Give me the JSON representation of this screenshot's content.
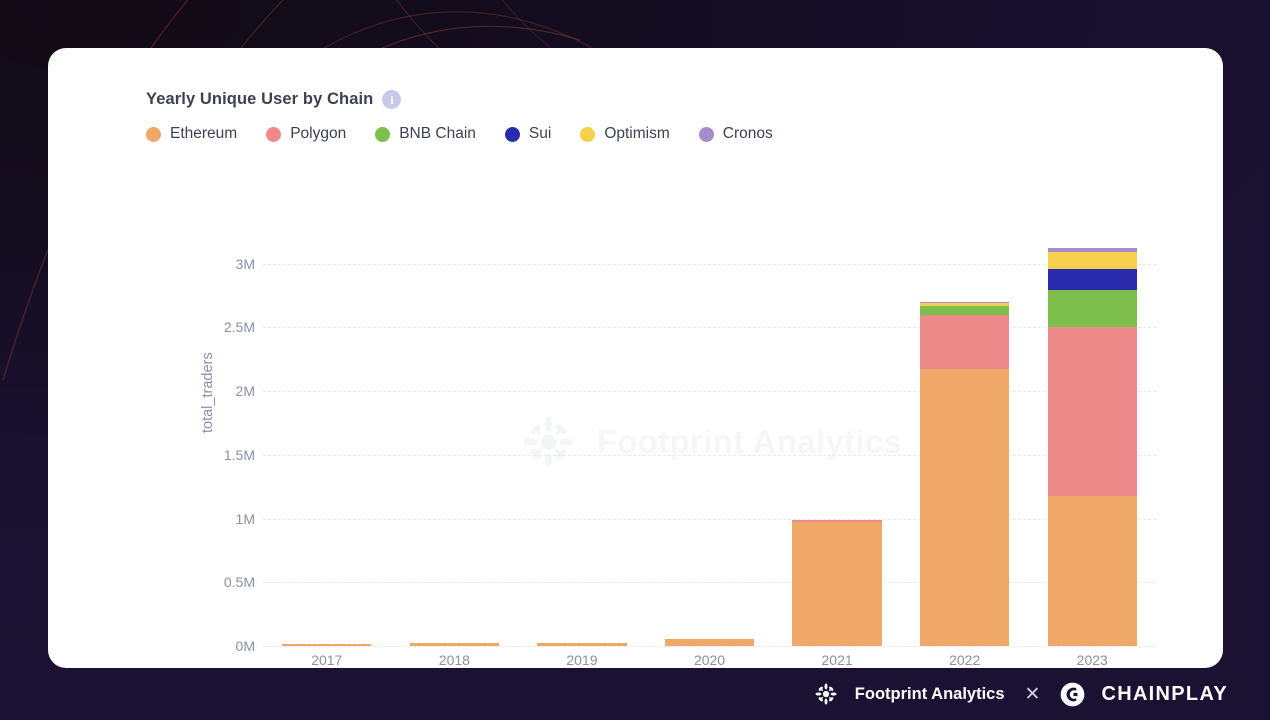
{
  "header": {
    "title": "Yearly Unique User by Chain",
    "info_icon": "info-icon",
    "info_glyph": "i"
  },
  "legend": {
    "items": [
      {
        "label": "Ethereum",
        "color": "#F0A868"
      },
      {
        "label": "Polygon",
        "color": "#EF8A8A"
      },
      {
        "label": "BNB Chain",
        "color": "#7DBE4C"
      },
      {
        "label": "Sui",
        "color": "#2A2AAD"
      },
      {
        "label": "Optimism",
        "color": "#F6D04D"
      },
      {
        "label": "Cronos",
        "color": "#A78BCA"
      }
    ]
  },
  "watermark": {
    "text": "Footprint Analytics",
    "icon": "footprint-sun-icon"
  },
  "footer": {
    "footprint_name": "Footprint Analytics",
    "footprint_icon": "footprint-sun-icon",
    "separator": "✕",
    "chainplay_name": "CHAINPLAY",
    "chainplay_icon": "chainplay-logo-icon"
  },
  "chart_data": {
    "type": "bar",
    "subtype": "stacked",
    "title": "Yearly Unique User by Chain",
    "xlabel": "",
    "ylabel": "total_traders",
    "categories": [
      "2017",
      "2018",
      "2019",
      "2020",
      "2021",
      "2022",
      "2023"
    ],
    "ytick_labels": [
      "0M",
      "0.5M",
      "1M",
      "1.5M",
      "2M",
      "2.5M",
      "3M"
    ],
    "ytick_values": [
      0,
      500000,
      1000000,
      1500000,
      2000000,
      2500000,
      3000000
    ],
    "ylim": [
      0,
      3200000
    ],
    "grid": true,
    "grid_style": "dashed",
    "legend_position": "top-left",
    "series": [
      {
        "name": "Ethereum",
        "color": "#F0A868",
        "values": [
          18000,
          22000,
          20000,
          55000,
          975000,
          2170000,
          1180000
        ]
      },
      {
        "name": "Polygon",
        "color": "#EF8A8A",
        "values": [
          0,
          0,
          0,
          0,
          12000,
          430000,
          1320000
        ]
      },
      {
        "name": "BNB Chain",
        "color": "#7DBE4C",
        "values": [
          0,
          0,
          0,
          0,
          0,
          70000,
          290000
        ]
      },
      {
        "name": "Sui",
        "color": "#2A2AAD",
        "values": [
          0,
          0,
          0,
          0,
          0,
          0,
          170000
        ]
      },
      {
        "name": "Optimism",
        "color": "#F6D04D",
        "values": [
          0,
          0,
          0,
          0,
          0,
          20000,
          130000
        ]
      },
      {
        "name": "Cronos",
        "color": "#A78BCA",
        "values": [
          0,
          0,
          0,
          0,
          0,
          10000,
          30000
        ]
      }
    ],
    "totals": [
      18000,
      22000,
      20000,
      55000,
      987000,
      2700000,
      3120000
    ]
  }
}
